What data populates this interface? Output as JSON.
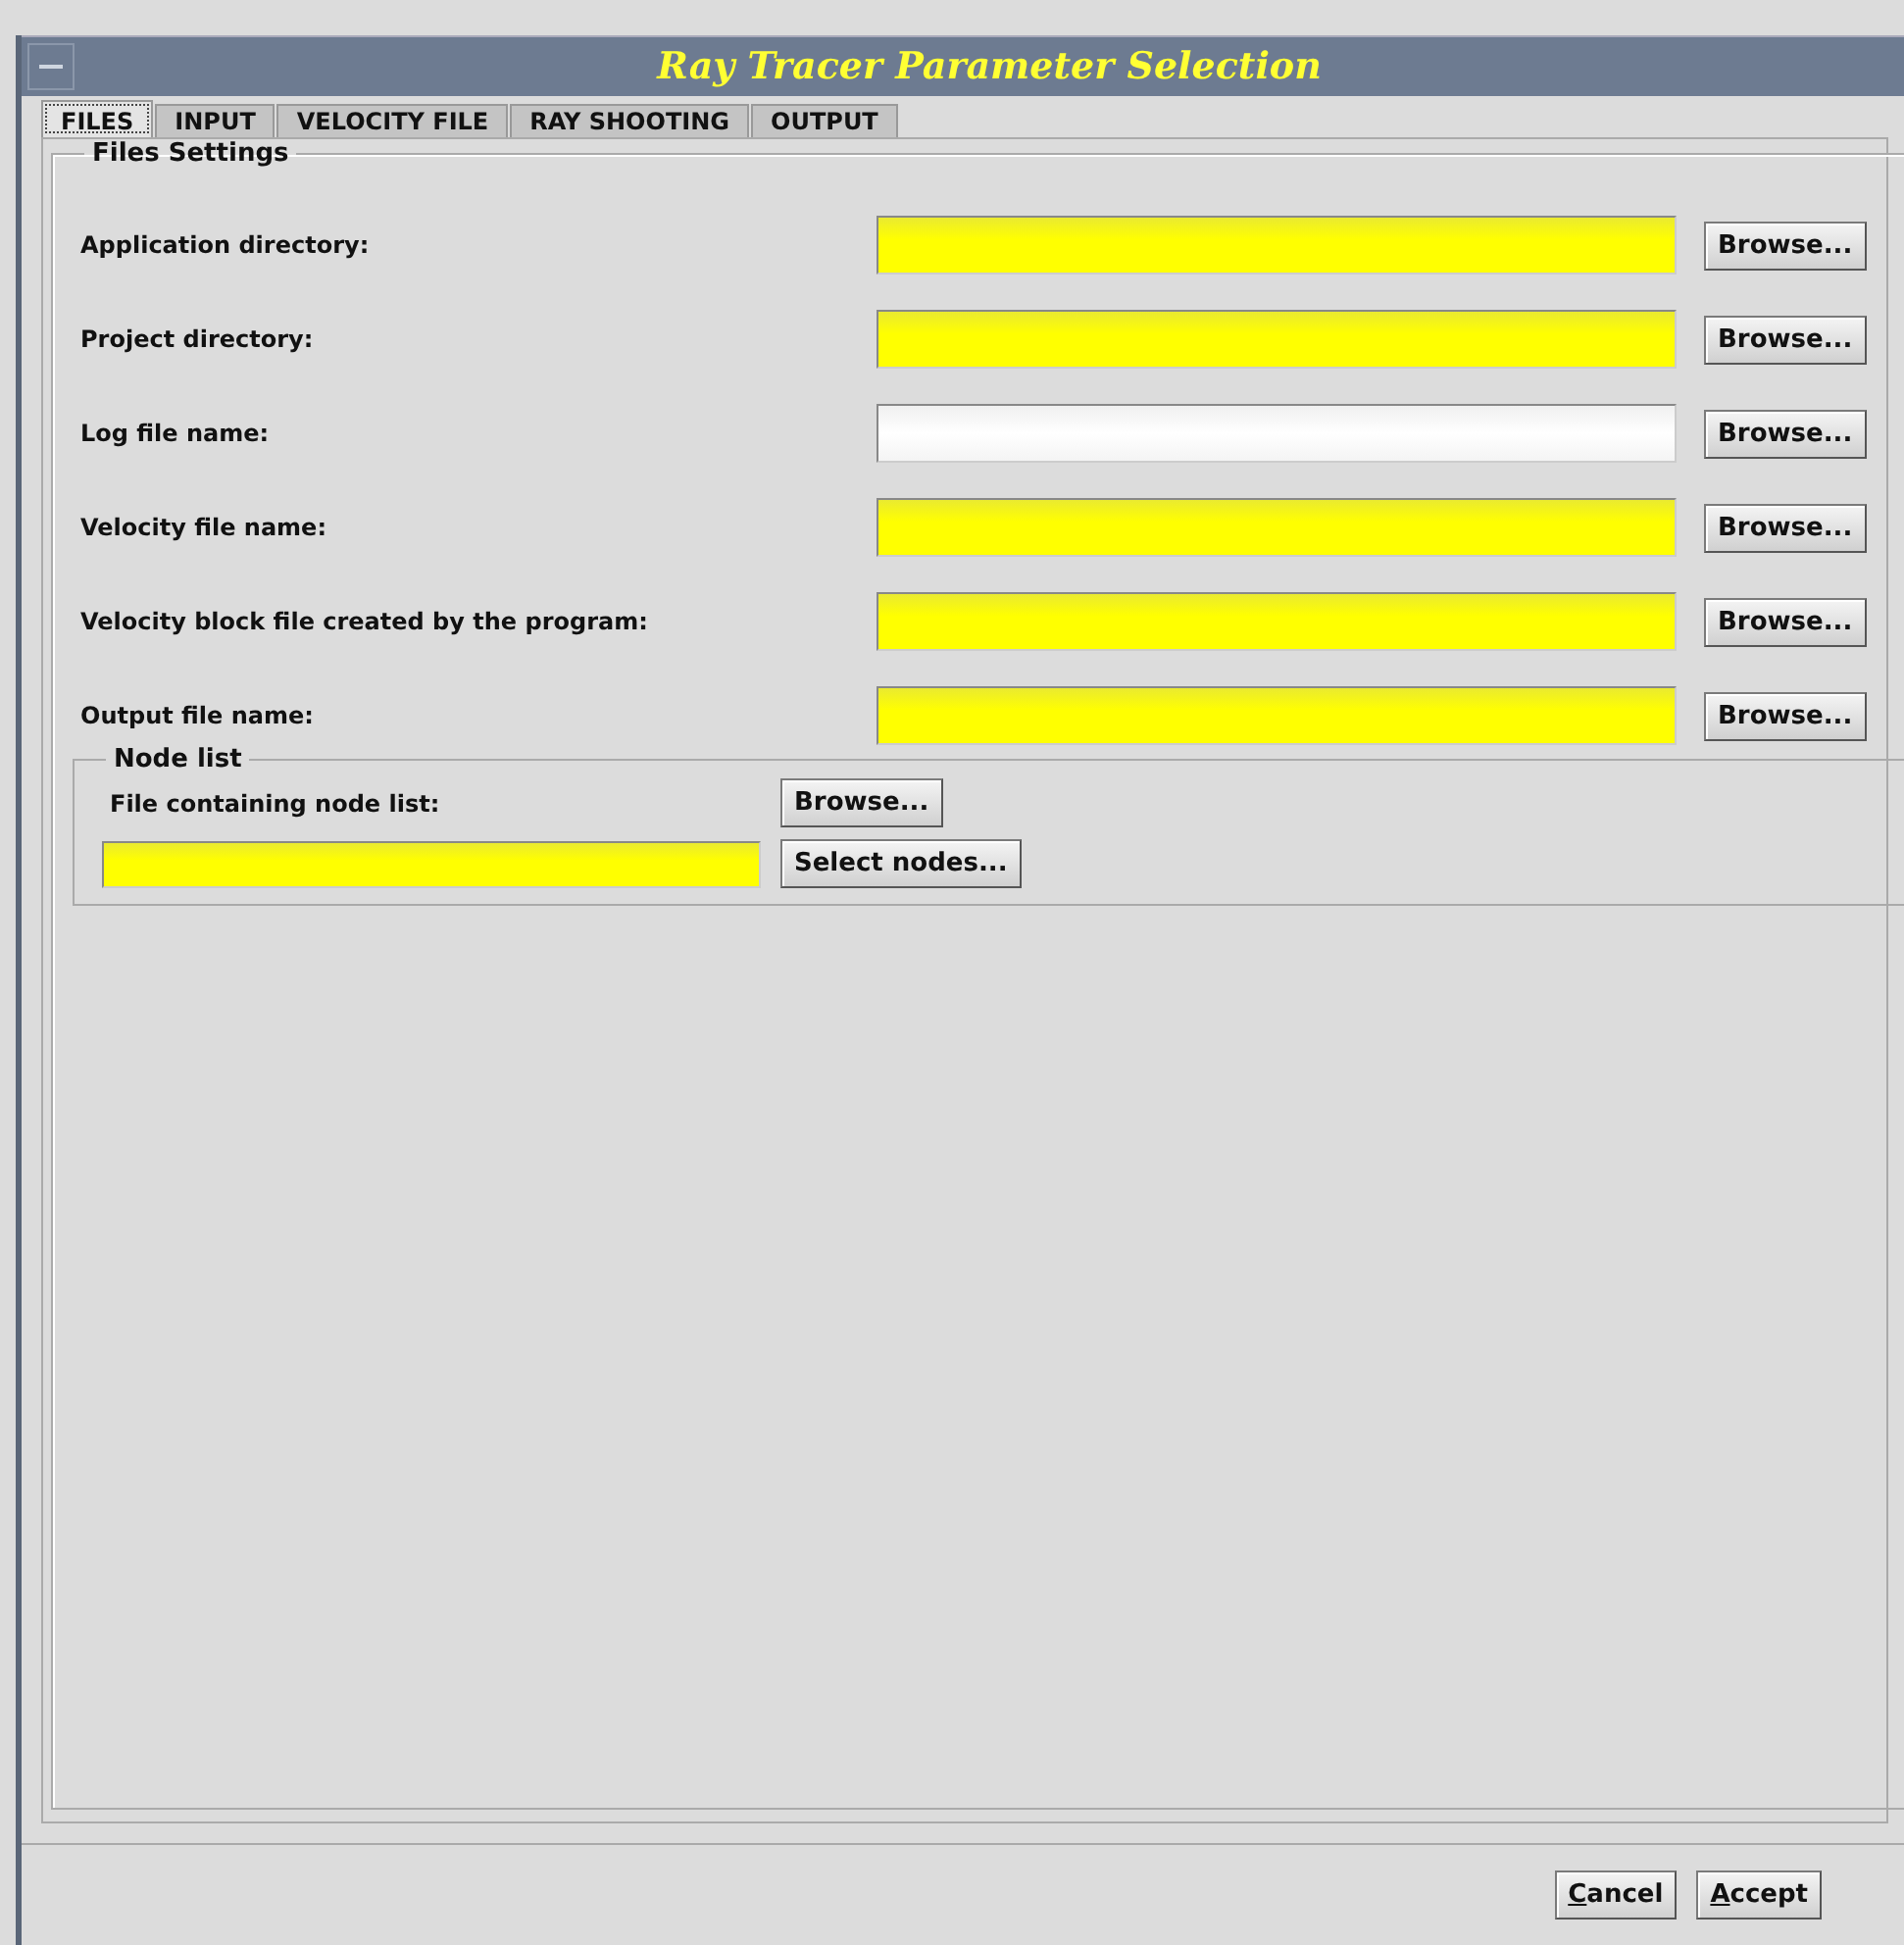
{
  "window": {
    "title": "Ray Tracer Parameter Selection"
  },
  "tabs": [
    {
      "label": "FILES",
      "selected": true
    },
    {
      "label": "INPUT",
      "selected": false
    },
    {
      "label": "VELOCITY FILE",
      "selected": false
    },
    {
      "label": "RAY SHOOTING",
      "selected": false
    },
    {
      "label": "OUTPUT",
      "selected": false
    }
  ],
  "files_settings": {
    "title": "Files Settings",
    "rows": [
      {
        "label": "Application directory:",
        "required": true,
        "button": "Browse..."
      },
      {
        "label": "Project directory:",
        "required": true,
        "button": "Browse..."
      },
      {
        "label": "Log file name:",
        "required": false,
        "button": "Browse..."
      },
      {
        "label": "Velocity file name:",
        "required": true,
        "button": "Browse..."
      },
      {
        "label": "Velocity block file created by the program:",
        "required": true,
        "button": "Browse..."
      },
      {
        "label": "Output file name:",
        "required": true,
        "button": "Browse..."
      }
    ]
  },
  "node_list": {
    "title": "Node list",
    "label": "File containing node list:",
    "browse_button": "Browse...",
    "required": true,
    "select_button": "Select nodes..."
  },
  "buttons": [
    "Cancel",
    "Accept"
  ]
}
